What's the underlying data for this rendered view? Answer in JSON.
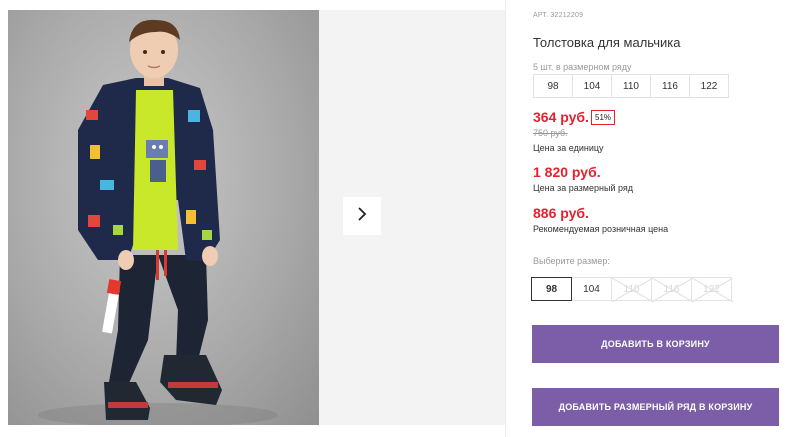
{
  "gallery": {
    "next_icon": "chevron-right-icon"
  },
  "product": {
    "article": "АРТ. 32212209",
    "title": "Толстовка для мальчика",
    "size_row_note": "5 шт. в размерном ряду",
    "size_row": [
      "98",
      "104",
      "110",
      "116",
      "122"
    ],
    "price_unit": "364 руб.",
    "discount": "51%",
    "price_old": "750 руб.",
    "price_unit_note": "Цена за единицу",
    "price_row": "1 820 руб.",
    "price_row_note": "Цена за размерный ряд",
    "price_retail": "886 руб.",
    "price_retail_note": "Рекомендуемая розничная цена",
    "choose_size_label": "Выберите размер:",
    "size_options": [
      {
        "label": "98",
        "state": "selected"
      },
      {
        "label": "104",
        "state": "available"
      },
      {
        "label": "110",
        "state": "disabled"
      },
      {
        "label": "116",
        "state": "disabled"
      },
      {
        "label": "122",
        "state": "disabled"
      }
    ]
  },
  "actions": {
    "add_to_cart": "ДОБАВИТЬ В КОРЗИНУ",
    "add_row_to_cart": "ДОБАВИТЬ РАЗМЕРНЫЙ РЯД В КОРЗИНУ"
  },
  "colors": {
    "accent_price": "#e4212f",
    "button": "#7b5ea7"
  }
}
